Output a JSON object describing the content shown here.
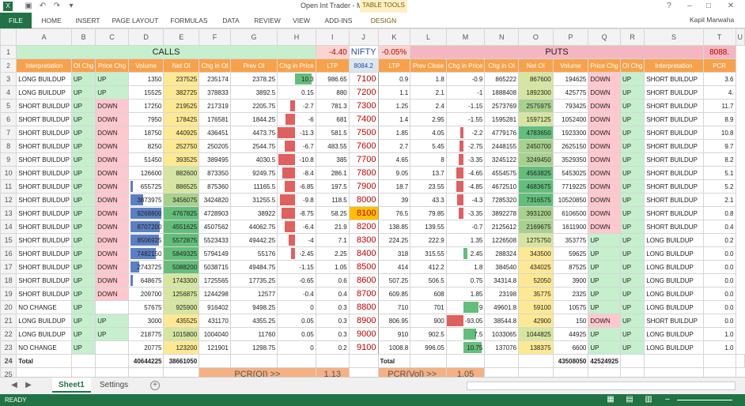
{
  "window": {
    "title": "Open Int Trader - Microsoft Excel",
    "user": "Kapil Marwaha"
  },
  "tabs": [
    "FILE",
    "HOME",
    "INSERT",
    "PAGE LAYOUT",
    "FORMULAS",
    "DATA",
    "REVIEW",
    "VIEW",
    "ADD-INS",
    "DESIGN"
  ],
  "table_tools_label": "TABLE TOOLS",
  "columns": [
    "A",
    "B",
    "C",
    "D",
    "E",
    "F",
    "G",
    "H",
    "I",
    "J",
    "K",
    "L",
    "M",
    "N",
    "O",
    "P",
    "Q",
    "R",
    "S",
    "T",
    "U"
  ],
  "row1": {
    "calls": "CALLS",
    "calls_chg": "-4.40",
    "nifty": "NIFTY",
    "nifty_chg": "-0.05%",
    "puts": "PUTS",
    "u1": "8088."
  },
  "headers": [
    "Interpretation",
    "OI Chg",
    "Price Chg",
    "Volume",
    "Net OI",
    "Chg in OI",
    "Prev OI",
    "Chg in Price",
    "LTP",
    "8084.2",
    "LTP",
    "Prev Close",
    "Chg in Price",
    "Chg in OI",
    "Net OI",
    "Volume",
    "Price Chg",
    "OI Chg",
    "Interpretation",
    "PCR"
  ],
  "rows": [
    [
      "LONG BUILDUP",
      "UP",
      "UP",
      "1350",
      "237525",
      "235174",
      "2378.25",
      "10.3",
      "986.65",
      "7100",
      "0.9",
      "1.8",
      "-0.9",
      "865222",
      "867600",
      "194625",
      "DOWN",
      "UP",
      "SHORT BUILDUP",
      "3.6"
    ],
    [
      "LONG BUILDUP",
      "UP",
      "UP",
      "15525",
      "382725",
      "378833",
      "3892.5",
      "0.15",
      "880",
      "7200",
      "1.1",
      "2.1",
      "-1",
      "1888408",
      "1892300",
      "425775",
      "DOWN",
      "UP",
      "SHORT BUILDUP",
      "4."
    ],
    [
      "SHORT BUILDUP",
      "UP",
      "DOWN",
      "17250",
      "219525",
      "217319",
      "2205.75",
      "-2.7",
      "781.3",
      "7300",
      "1.25",
      "2.4",
      "-1.15",
      "2573769",
      "2575975",
      "793425",
      "DOWN",
      "UP",
      "SHORT BUILDUP",
      "11.7"
    ],
    [
      "SHORT BUILDUP",
      "UP",
      "DOWN",
      "7950",
      "178425",
      "176581",
      "1844.25",
      "-6",
      "681",
      "7400",
      "1.4",
      "2.95",
      "-1.55",
      "1595281",
      "1597125",
      "1052400",
      "DOWN",
      "UP",
      "SHORT BUILDUP",
      "8.9"
    ],
    [
      "SHORT BUILDUP",
      "UP",
      "DOWN",
      "18750",
      "440925",
      "436451",
      "4473.75",
      "-11.3",
      "581.5",
      "7500",
      "1.85",
      "4.05",
      "-2.2",
      "4779176",
      "4783650",
      "1923300",
      "DOWN",
      "UP",
      "SHORT BUILDUP",
      "10.8"
    ],
    [
      "SHORT BUILDUP",
      "UP",
      "DOWN",
      "8250",
      "252750",
      "250205",
      "2544.75",
      "-6.7",
      "483.55",
      "7600",
      "2.7",
      "5.45",
      "-2.75",
      "2448155",
      "2450700",
      "2625150",
      "DOWN",
      "UP",
      "SHORT BUILDUP",
      "9.7"
    ],
    [
      "SHORT BUILDUP",
      "UP",
      "DOWN",
      "51450",
      "393525",
      "389495",
      "4030.5",
      "-10.8",
      "385",
      "7700",
      "4.65",
      "8",
      "-3.35",
      "3245122",
      "3249450",
      "3529350",
      "DOWN",
      "UP",
      "SHORT BUILDUP",
      "8.2"
    ],
    [
      "SHORT BUILDUP",
      "UP",
      "DOWN",
      "126600",
      "882600",
      "873350",
      "9249.75",
      "-8.4",
      "286.1",
      "7800",
      "9.05",
      "13.7",
      "-4.65",
      "4554575",
      "4563825",
      "5453025",
      "DOWN",
      "UP",
      "SHORT BUILDUP",
      "5.1"
    ],
    [
      "SHORT BUILDUP",
      "UP",
      "DOWN",
      "655725",
      "886525",
      "875360",
      "11165.5",
      "-6.85",
      "197.5",
      "7900",
      "18.7",
      "23.55",
      "-4.85",
      "4672510",
      "4683675",
      "7719225",
      "DOWN",
      "UP",
      "SHORT BUILDUP",
      "5.2"
    ],
    [
      "SHORT BUILDUP",
      "UP",
      "DOWN",
      "3873975",
      "3456075",
      "3424820",
      "31255.5",
      "-9.8",
      "118.5",
      "8000",
      "39",
      "43.3",
      "-4.3",
      "7285320",
      "7316575",
      "10520850",
      "DOWN",
      "UP",
      "SHORT BUILDUP",
      "2.1"
    ],
    [
      "SHORT BUILDUP",
      "UP",
      "DOWN",
      "9268800",
      "4767825",
      "4728903",
      "38922",
      "-8.75",
      "58.25",
      "8100",
      "76.5",
      "79.85",
      "-3.35",
      "3892278",
      "3931200",
      "6106500",
      "DOWN",
      "UP",
      "SHORT BUILDUP",
      "0.8"
    ],
    [
      "SHORT BUILDUP",
      "UP",
      "DOWN",
      "8707200",
      "4551625",
      "4507562",
      "44062.75",
      "-6.4",
      "21.9",
      "8200",
      "138.85",
      "139.55",
      "-0.7",
      "2125612",
      "2169675",
      "1611900",
      "DOWN",
      "UP",
      "SHORT BUILDUP",
      "0.4"
    ],
    [
      "SHORT BUILDUP",
      "UP",
      "DOWN",
      "8506925",
      "5572875",
      "5523433",
      "49442.25",
      "-4",
      "7.1",
      "8300",
      "224.25",
      "222.9",
      "1.35",
      "1226508",
      "1275750",
      "353775",
      "UP",
      "UP",
      "LONG BUILDUP",
      "0.2"
    ],
    [
      "SHORT BUILDUP",
      "UP",
      "DOWN",
      "7482150",
      "5849325",
      "5794149",
      "55176",
      "-2.45",
      "2.25",
      "8400",
      "318",
      "315.55",
      "2.45",
      "288324",
      "343500",
      "59625",
      "UP",
      "UP",
      "LONG BUILDUP",
      "0.0"
    ],
    [
      "SHORT BUILDUP",
      "UP",
      "DOWN",
      "2743725",
      "5088200",
      "5038715",
      "49484.75",
      "-1.15",
      "1.05",
      "8500",
      "414",
      "412.2",
      "1.8",
      "384540",
      "434025",
      "87525",
      "UP",
      "UP",
      "LONG BUILDUP",
      "0.0"
    ],
    [
      "SHORT BUILDUP",
      "UP",
      "DOWN",
      "648675",
      "1743300",
      "1725565",
      "17735.25",
      "-0.65",
      "0.6",
      "8600",
      "507.25",
      "506.5",
      "0.75",
      "34314.8",
      "52050",
      "3900",
      "UP",
      "UP",
      "LONG BUILDUP",
      "0.0"
    ],
    [
      "SHORT BUILDUP",
      "UP",
      "DOWN",
      "209700",
      "1256875",
      "1244298",
      "12577",
      "-0.4",
      "0.4",
      "8700",
      "609.85",
      "608",
      "1.85",
      "23198",
      "35775",
      "2325",
      "UP",
      "UP",
      "LONG BUILDUP",
      "0.0"
    ],
    [
      "NO CHANGE",
      "UP",
      "",
      "57675",
      "925900",
      "916402",
      "9498.25",
      "0",
      "0.3",
      "8800",
      "710",
      "701",
      "9",
      "49601.8",
      "59100",
      "10575",
      "UP",
      "UP",
      "LONG BUILDUP",
      "0.0"
    ],
    [
      "LONG BUILDUP",
      "UP",
      "UP",
      "3000",
      "435525",
      "431170",
      "4355.25",
      "0.05",
      "0.3",
      "8900",
      "806.95",
      "900",
      "-93.05",
      "38544.8",
      "42900",
      "150",
      "DOWN",
      "UP",
      "SHORT BUILDUP",
      "0.0"
    ],
    [
      "LONG BUILDUP",
      "UP",
      "UP",
      "218775",
      "1015800",
      "1004040",
      "11760",
      "0.05",
      "0.3",
      "9000",
      "910",
      "902.5",
      "7.5",
      "1033065",
      "1044825",
      "44925",
      "UP",
      "UP",
      "LONG BUILDUP",
      "1.0"
    ],
    [
      "NO CHANGE",
      "UP",
      "",
      "20775",
      "123200",
      "121901",
      "1298.75",
      "0",
      "0.2",
      "9100",
      "1008.8",
      "996.05",
      "10.75",
      "137076",
      "138375",
      "6600",
      "UP",
      "UP",
      "LONG BUILDUP",
      "1.0"
    ]
  ],
  "total": {
    "label": "Total",
    "call_volume": "40644225",
    "call_oi": "38661050",
    "put_label": "Total",
    "put_oi": "43508050",
    "put_volume": "42524925"
  },
  "pcr": {
    "oi_label": "PCR(OI) >>",
    "oi_value": "1.13",
    "vol_label": "PCR(Vol) >>",
    "vol_value": "1.05"
  },
  "sheets": [
    "Sheet1",
    "Settings"
  ],
  "status": "READY"
}
